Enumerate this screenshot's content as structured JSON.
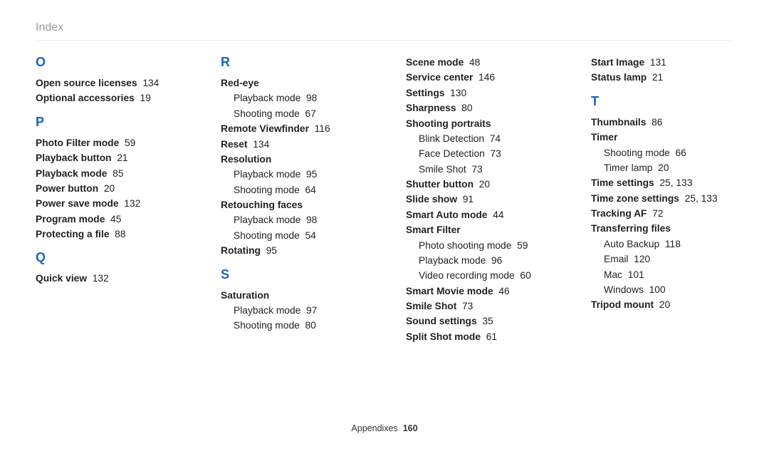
{
  "title": "Index",
  "footer": {
    "label": "Appendixes",
    "page": "160"
  },
  "cols": [
    [
      {
        "type": "letter",
        "text": "O",
        "first": true
      },
      {
        "type": "entry",
        "topic": "Open source licenses",
        "page": "134"
      },
      {
        "type": "entry",
        "topic": "Optional accessories",
        "page": "19"
      },
      {
        "type": "letter",
        "text": "P"
      },
      {
        "type": "entry",
        "topic": "Photo Filter mode",
        "page": "59"
      },
      {
        "type": "entry",
        "topic": "Playback button",
        "page": "21"
      },
      {
        "type": "entry",
        "topic": "Playback mode",
        "page": "85"
      },
      {
        "type": "entry",
        "topic": "Power button",
        "page": "20"
      },
      {
        "type": "entry",
        "topic": "Power save mode",
        "page": "132"
      },
      {
        "type": "entry",
        "topic": "Program mode",
        "page": "45"
      },
      {
        "type": "entry",
        "topic": "Protecting a file",
        "page": "88"
      },
      {
        "type": "letter",
        "text": "Q"
      },
      {
        "type": "entry",
        "topic": "Quick view",
        "page": "132"
      }
    ],
    [
      {
        "type": "letter",
        "text": "R",
        "first": true
      },
      {
        "type": "head",
        "topic": "Red-eye"
      },
      {
        "type": "sub",
        "label": "Playback mode",
        "page": "98"
      },
      {
        "type": "sub",
        "label": "Shooting mode",
        "page": "67"
      },
      {
        "type": "entry",
        "topic": "Remote Viewfinder",
        "page": "116"
      },
      {
        "type": "entry",
        "topic": "Reset",
        "page": "134"
      },
      {
        "type": "head",
        "topic": "Resolution"
      },
      {
        "type": "sub",
        "label": "Playback mode",
        "page": "95"
      },
      {
        "type": "sub",
        "label": "Shooting mode",
        "page": "64"
      },
      {
        "type": "head",
        "topic": "Retouching faces"
      },
      {
        "type": "sub",
        "label": "Playback mode",
        "page": "98"
      },
      {
        "type": "sub",
        "label": "Shooting mode",
        "page": "54"
      },
      {
        "type": "entry",
        "topic": "Rotating",
        "page": "95"
      },
      {
        "type": "letter",
        "text": "S"
      },
      {
        "type": "head",
        "topic": "Saturation"
      },
      {
        "type": "sub",
        "label": "Playback mode",
        "page": "97"
      },
      {
        "type": "sub",
        "label": "Shooting mode",
        "page": "80"
      }
    ],
    [
      {
        "type": "entry",
        "topic": "Scene mode",
        "page": "48"
      },
      {
        "type": "entry",
        "topic": "Service center",
        "page": "146"
      },
      {
        "type": "entry",
        "topic": "Settings",
        "page": "130"
      },
      {
        "type": "entry",
        "topic": "Sharpness",
        "page": "80"
      },
      {
        "type": "head",
        "topic": "Shooting portraits"
      },
      {
        "type": "sub",
        "label": "Blink Detection",
        "page": "74"
      },
      {
        "type": "sub",
        "label": "Face Detection",
        "page": "73"
      },
      {
        "type": "sub",
        "label": "Smile Shot",
        "page": "73"
      },
      {
        "type": "entry",
        "topic": "Shutter button",
        "page": "20"
      },
      {
        "type": "entry",
        "topic": "Slide show",
        "page": "91"
      },
      {
        "type": "entry",
        "topic": "Smart Auto mode",
        "page": "44"
      },
      {
        "type": "head",
        "topic": "Smart Filter"
      },
      {
        "type": "sub",
        "label": "Photo shooting mode",
        "page": "59"
      },
      {
        "type": "sub",
        "label": "Playback mode",
        "page": "96"
      },
      {
        "type": "sub",
        "label": "Video recording mode",
        "page": "60"
      },
      {
        "type": "entry",
        "topic": "Smart Movie mode",
        "page": "46"
      },
      {
        "type": "entry",
        "topic": "Smile Shot",
        "page": "73"
      },
      {
        "type": "entry",
        "topic": "Sound settings",
        "page": "35"
      },
      {
        "type": "entry",
        "topic": "Split Shot mode",
        "page": "61"
      }
    ],
    [
      {
        "type": "entry",
        "topic": "Start Image",
        "page": "131"
      },
      {
        "type": "entry",
        "topic": "Status lamp",
        "page": "21"
      },
      {
        "type": "letter",
        "text": "T"
      },
      {
        "type": "entry",
        "topic": "Thumbnails",
        "page": "86"
      },
      {
        "type": "head",
        "topic": "Timer"
      },
      {
        "type": "sub",
        "label": "Shooting mode",
        "page": "66"
      },
      {
        "type": "sub",
        "label": "Timer lamp",
        "page": "20"
      },
      {
        "type": "entry",
        "topic": "Time settings",
        "page": "25, 133"
      },
      {
        "type": "entry",
        "topic": "Time zone settings",
        "page": "25, 133"
      },
      {
        "type": "entry",
        "topic": "Tracking AF",
        "page": "72"
      },
      {
        "type": "head",
        "topic": "Transferring files"
      },
      {
        "type": "sub",
        "label": "Auto Backup",
        "page": "118"
      },
      {
        "type": "sub",
        "label": "Email",
        "page": "120"
      },
      {
        "type": "sub",
        "label": "Mac",
        "page": "101"
      },
      {
        "type": "sub",
        "label": "Windows",
        "page": "100"
      },
      {
        "type": "entry",
        "topic": "Tripod mount",
        "page": "20"
      }
    ]
  ]
}
